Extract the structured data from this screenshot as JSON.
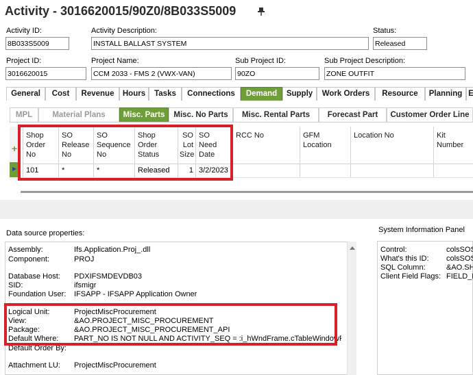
{
  "header": {
    "title": "Activity - 3016620015/90Z0/8B033S5009"
  },
  "form": {
    "activity_id": {
      "label": "Activity ID:",
      "value": "8B033S5009"
    },
    "activity_description": {
      "label": "Activity Description:",
      "value": "INSTALL BALLAST SYSTEM"
    },
    "status": {
      "label": "Status:",
      "value": "Released"
    },
    "project_id": {
      "label": "Project ID:",
      "value": "3016620015"
    },
    "project_name": {
      "label": "Project Name:",
      "value": "CCM 2033 - FMS 2 (VWX-VAN)"
    },
    "sub_project_id": {
      "label": "Sub Project ID:",
      "value": "90ZO"
    },
    "sub_project_description": {
      "label": "Sub Project Description:",
      "value": "ZONE OUTFIT"
    }
  },
  "main_tabs": [
    "General",
    "Cost",
    "Revenue",
    "Hours",
    "Tasks",
    "Connections",
    "Demand",
    "Supply",
    "Work Orders",
    "Resource",
    "Planning",
    "E"
  ],
  "main_tabs_active": "Demand",
  "sub_tabs": [
    "MPL",
    "Material Plans",
    "Misc. Parts",
    "Misc. No Parts",
    "Misc. Rental Parts",
    "Forecast Part",
    "Customer Order Line"
  ],
  "sub_tabs_active": "Misc. Parts",
  "grid": {
    "columns": [
      {
        "line1": "Shop",
        "line2": "Order",
        "line3": "No"
      },
      {
        "line1": "SO",
        "line2": "Release",
        "line3": "No"
      },
      {
        "line1": "SO",
        "line2": "Sequence",
        "line3": "No"
      },
      {
        "line1": "Shop",
        "line2": "Order",
        "line3": "Status"
      },
      {
        "line1": "SO",
        "line2": "Lot",
        "line3": "Size"
      },
      {
        "line1": "SO",
        "line2": "Need",
        "line3": "Date"
      },
      {
        "line1": "RCC No",
        "line2": "",
        "line3": ""
      },
      {
        "line1": "GFM Location",
        "line2": "",
        "line3": ""
      },
      {
        "line1": "Location No",
        "line2": "",
        "line3": ""
      },
      {
        "line1": "Kit Number",
        "line2": "",
        "line3": ""
      }
    ],
    "row": [
      "101",
      "*",
      "*",
      "Released",
      "1",
      "3/2/2023",
      "",
      "",
      "",
      ""
    ]
  },
  "data_source": {
    "title": "Data source properties:",
    "rows": [
      {
        "key": "Assembly:",
        "value": "Ifs.Application.Proj_.dll"
      },
      {
        "key": "Component:",
        "value": "PROJ"
      },
      {
        "key": "Database Host:",
        "value": "PDXIFSMDEVDB03"
      },
      {
        "key": "SID:",
        "value": "ifsmigr"
      },
      {
        "key": "Foundation User:",
        "value": "IFSAPP - IFSAPP Application Owner"
      },
      {
        "key": "Logical Unit:",
        "value": "ProjectMiscProcurement"
      },
      {
        "key": "View:",
        "value": "&AO.PROJECT_MISC_PROCUREMENT"
      },
      {
        "key": "Package:",
        "value": "&AO.PROJECT_MISC_PROCUREMENT_API"
      },
      {
        "key": "Default Where:",
        "value": "PART_NO IS NOT NULL AND  ACTIVITY_SEQ = :i_hWndFrame.cTableWindowProj"
      },
      {
        "key": "Default Order By:",
        "value": ""
      },
      {
        "key": "Attachment LU:",
        "value": "ProjectMiscProcurement"
      }
    ]
  },
  "system_info": {
    "title": "System Information Panel",
    "rows": [
      {
        "key": "Control:",
        "value": "colsSOS"
      },
      {
        "key": "What's this ID:",
        "value": "colsSOS"
      },
      {
        "key": "SQL Column:",
        "value": "&AO.SH"
      },
      {
        "key": "Client Field Flags:",
        "value": "FIELD_E"
      }
    ]
  },
  "colors": {
    "accent": "#6e9e37",
    "highlight": "#d81f2a"
  }
}
